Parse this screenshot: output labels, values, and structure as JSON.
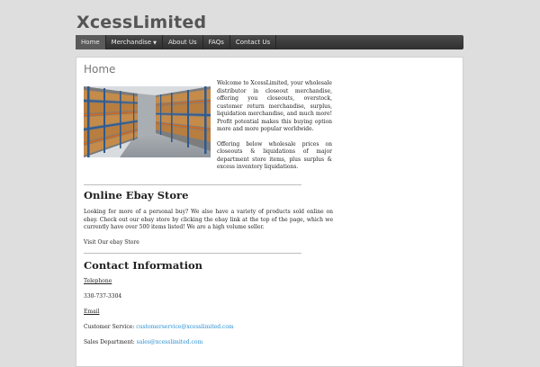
{
  "site": {
    "title": "XcessLimited"
  },
  "nav": {
    "items": [
      {
        "label": "Home"
      },
      {
        "label": "Merchandise"
      },
      {
        "label": "About Us"
      },
      {
        "label": "FAQs"
      },
      {
        "label": "Contact Us"
      }
    ]
  },
  "main": {
    "heading": "Home",
    "hero_image_icon": "warehouse-shelves-image",
    "intro_paragraphs": [
      "Welcome to XcessLimited, your wholesale distributor in closeout merchandise, offering you closeouts, overstock, customer return merchandise, surplus, liquidation merchandise, and much more! Profit potential makes this buying option more and more popular worldwide.",
      "Offering below wholesale prices on closeouts & liquidations of major department store items, plus surplus & excess inventory liquidations."
    ],
    "ebay": {
      "heading": "Online Ebay Store",
      "text": "Looking for more of a personal buy? We also have a variety of products sold online on ebay. Check out our ebay store by clicking the ebay link at the top of the page, which we currently have over 500 items listed! We are a high volume seller.",
      "link_label": "Visit Our ebay Store"
    },
    "contact": {
      "heading": "Contact Information",
      "telephone_label": "Telephone",
      "telephone_value": "330-737-3304",
      "email_label": "Email",
      "service_label": "Customer Service:",
      "service_email": "customerservice@xcesslimited.com",
      "sales_label": "Sales Department:",
      "sales_email": "sales@xcesslimited.com"
    }
  }
}
